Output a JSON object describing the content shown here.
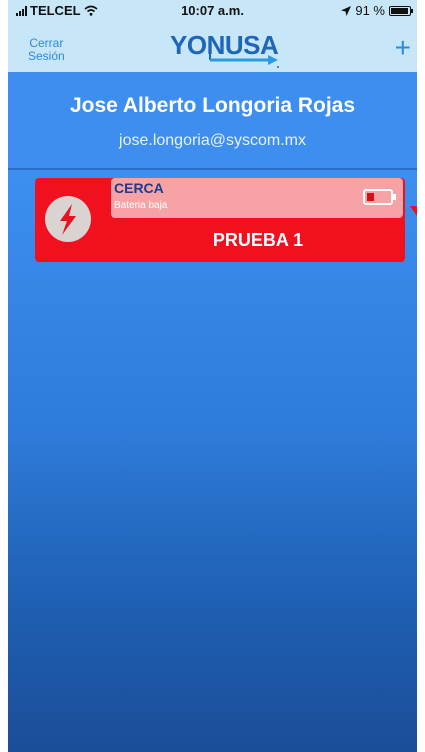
{
  "status_bar": {
    "carrier": "TELCEL",
    "time": "10:07 a.m.",
    "battery_percent": "91 %",
    "battery_level": 0.91
  },
  "header": {
    "logout_label": "Cerrar\nSesión",
    "logo_text": "YONUSA",
    "add_label": "+"
  },
  "profile": {
    "name": "Jose Alberto  Longoria Rojas",
    "email": "jose.longoria@syscom.mx"
  },
  "devices": [
    {
      "zone": "CERCA",
      "status": "Bateria baja",
      "name": "PRUEBA 1",
      "card_color": "#f0101e",
      "icon": "lightning-icon",
      "battery_icon": "low-battery-icon"
    }
  ],
  "colors": {
    "header_bg": "#c7e6f8",
    "accent": "#2a8bd9",
    "alert_red": "#f0101e"
  }
}
